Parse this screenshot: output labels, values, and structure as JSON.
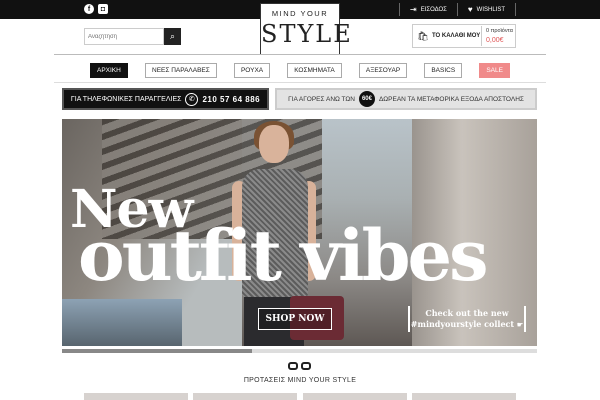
{
  "topbar": {
    "social": [
      "f",
      "◘"
    ],
    "login_label": "ΕΙΣΟΔΟΣ",
    "wishlist_label": "WISHLIST"
  },
  "logo": {
    "line1": "MIND YOUR",
    "line2": "STYLE"
  },
  "search": {
    "placeholder": "Αναζήτηση"
  },
  "cart": {
    "label": "ΤΟ ΚΑΛΑΘΙ ΜΟΥ",
    "items": "0 προϊόντα",
    "price": "0,00€"
  },
  "nav": {
    "items": [
      {
        "label": "ΑΡΧΙΚΗ"
      },
      {
        "label": "ΝΕΕΣ ΠΑΡΑΛΑΒΕΣ"
      },
      {
        "label": "ΡΟΥΧΑ"
      },
      {
        "label": "ΚΟΣΜΗΜΑΤΑ"
      },
      {
        "label": "ΑΞΕΣΟΥΑΡ"
      },
      {
        "label": "BASICS"
      },
      {
        "label": "SALE"
      }
    ]
  },
  "promo": {
    "phone_text": "ΓΙΑ ΤΗΛΕΦΩΝΙΚΕΣ ΠΑΡΑΓΓΕΛΙΕΣ",
    "phone_number": "210 57 64 886",
    "shipping_prefix": "ΓΙΑ ΑΓΟΡΕΣ ΑΝΩ ΤΩΝ",
    "shipping_amount": "60€",
    "shipping_suffix": "ΔΩΡΕΑΝ ΤΑ ΜΕΤΑΦΟΡΙΚΑ ΕΞΟΔΑ ΑΠΟΣΤΟΛΗΣ"
  },
  "hero": {
    "title_line1": "New",
    "title_line2": "outfit vibes",
    "shop_button": "SHOP NOW",
    "cta_line1": "Check out the new",
    "cta_line2": "#mindyourstyle collect"
  },
  "section": {
    "title": "ΠΡΟΤΑΣΕΙΣ MIND YOUR STYLE"
  },
  "colors": {
    "topbar": "#111111",
    "sale": "#f08a8a",
    "price": "#e05656"
  }
}
